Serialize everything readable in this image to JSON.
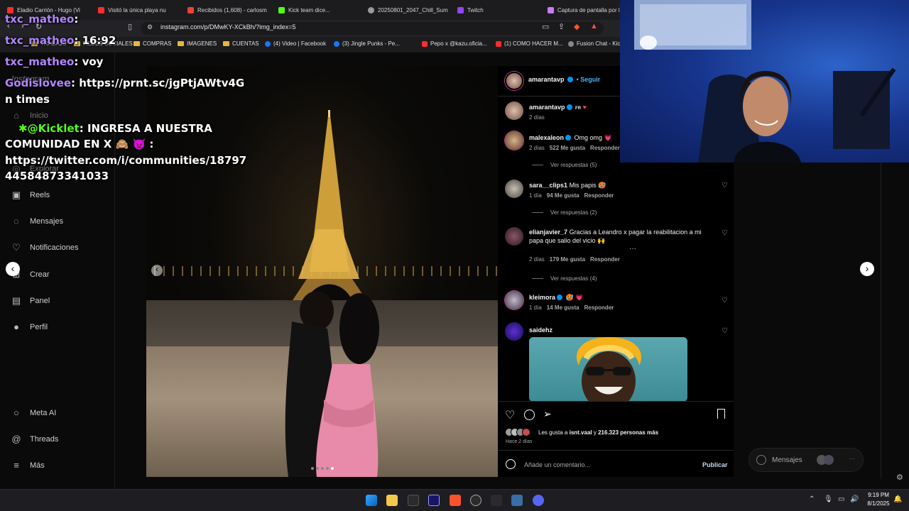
{
  "browser": {
    "tabs": [
      {
        "label": "Eladio Carrión - Hugo (Vi",
        "color": "#ff2d2d"
      },
      {
        "label": "Visitó la única playa nu",
        "color": "#ff2d2d"
      },
      {
        "label": "Recibidos (1,608) - carlosm",
        "color": "#ea4335"
      },
      {
        "label": "Kick team dice...",
        "color": "#53fc18"
      },
      {
        "label": "20250801_2047_Chill_Sum",
        "color": "#9a9a9a"
      },
      {
        "label": "Twitch",
        "color": "#9146ff"
      },
      {
        "label": "Captura de pantalla por l",
        "color": "#c97bff"
      }
    ],
    "url": "instagram.com/p/DMwKY-XCkBh/?img_index=5",
    "bookmarks": [
      {
        "label": "TRABAJO",
        "type": "folder"
      },
      {
        "label": "REDES SOCIALES",
        "type": "folder"
      },
      {
        "label": "COMPRAS",
        "type": "folder"
      },
      {
        "label": "IMAGENES",
        "type": "folder"
      },
      {
        "label": "CUENTAS",
        "type": "folder"
      },
      {
        "label": "(4) Video | Facebook",
        "type": "facebook"
      },
      {
        "label": "(3) Jingle Punks - Pe...",
        "type": "facebook"
      },
      {
        "label": "Pepo x @kazu.oficia...",
        "type": "youtube"
      },
      {
        "label": "(1) COMO HACER M...",
        "type": "youtube"
      },
      {
        "label": "Fusion Chat - Kic",
        "type": "other"
      }
    ]
  },
  "sidebar": {
    "logo": "Instagram",
    "items": [
      {
        "label": "Inicio",
        "icon": "home-icon"
      },
      {
        "label": "Explorar",
        "icon": "compass-icon"
      },
      {
        "label": "Reels",
        "icon": "reels-icon"
      },
      {
        "label": "Mensajes",
        "icon": "messenger-icon"
      },
      {
        "label": "Notificaciones",
        "icon": "heart-icon"
      },
      {
        "label": "Crear",
        "icon": "plus-icon"
      },
      {
        "label": "Panel",
        "icon": "dashboard-icon"
      },
      {
        "label": "Perfil",
        "icon": "profile-icon"
      },
      {
        "label": "Meta AI",
        "icon": "meta-ai-icon"
      },
      {
        "label": "Threads",
        "icon": "threads-icon"
      },
      {
        "label": "Más",
        "icon": "menu-icon"
      }
    ]
  },
  "post": {
    "author": "amarantavp",
    "follow": "Seguir",
    "caption_suffix": "FR",
    "caption_time": "2 días",
    "likes_text": "Les gusta a",
    "likes_user": "isnt.vaal",
    "likes_and": "y",
    "likes_count": "216.323 personas más",
    "time": "Hace 2 días",
    "comment_placeholder": "Añade un comentario...",
    "publish": "Publicar"
  },
  "comments": [
    {
      "user": "malexaleon",
      "text": "Omg omg 💗",
      "time": "2 días",
      "likes": "522 Me gusta",
      "reply": "Responder",
      "replies": "Ver respuestas (5)",
      "verified": true
    },
    {
      "user": "sara__clips1",
      "text": "Mis papis 🥵",
      "time": "1 día",
      "likes": "94 Me gusta",
      "reply": "Responder",
      "replies": "Ver respuestas (2)",
      "verified": false
    },
    {
      "user": "elianjavier_7",
      "text": "Gracias a Leandro x pagar la reabilitacion a mi papa que salio del vicio 🙌",
      "time": "2 días",
      "likes": "179 Me gusta",
      "reply": "Responder",
      "replies": "Ver respuestas (4)",
      "verified": false
    },
    {
      "user": "kleimora",
      "text": "🥵 💗",
      "time": "1 día",
      "likes": "14 Me gusta",
      "reply": "Responder",
      "replies": "",
      "verified": true
    },
    {
      "user": "saidehz",
      "text": "",
      "time": "",
      "likes": "",
      "reply": "",
      "replies": "",
      "verified": false
    }
  ],
  "chat": [
    {
      "user": "txc_matheo",
      "text": ""
    },
    {
      "user": "txc_matheo",
      "text": "16:92"
    },
    {
      "user": "txc_matheo",
      "text": "voy"
    },
    {
      "user": "Godislovee",
      "text": "https://prnt.sc/jgPtjAWtv4G"
    },
    {
      "user": "",
      "text": "n times"
    },
    {
      "user": "@Kicklet",
      "text": "INGRESA A NUESTRA"
    },
    {
      "user": "",
      "text": "COMUNIDAD EN X 🙈 👿 :"
    },
    {
      "user": "",
      "text": "https://twitter.com/i/communities/18797"
    },
    {
      "user": "",
      "text": "44584873341033"
    }
  ],
  "dock": {
    "messages": "Mensajes"
  },
  "taskbar": {
    "time": "9:19 PM",
    "date": "8/1/2025"
  },
  "colors": {
    "accent": "#0095f6",
    "chat_user": "#b286ff",
    "verified": "#0095f6"
  }
}
